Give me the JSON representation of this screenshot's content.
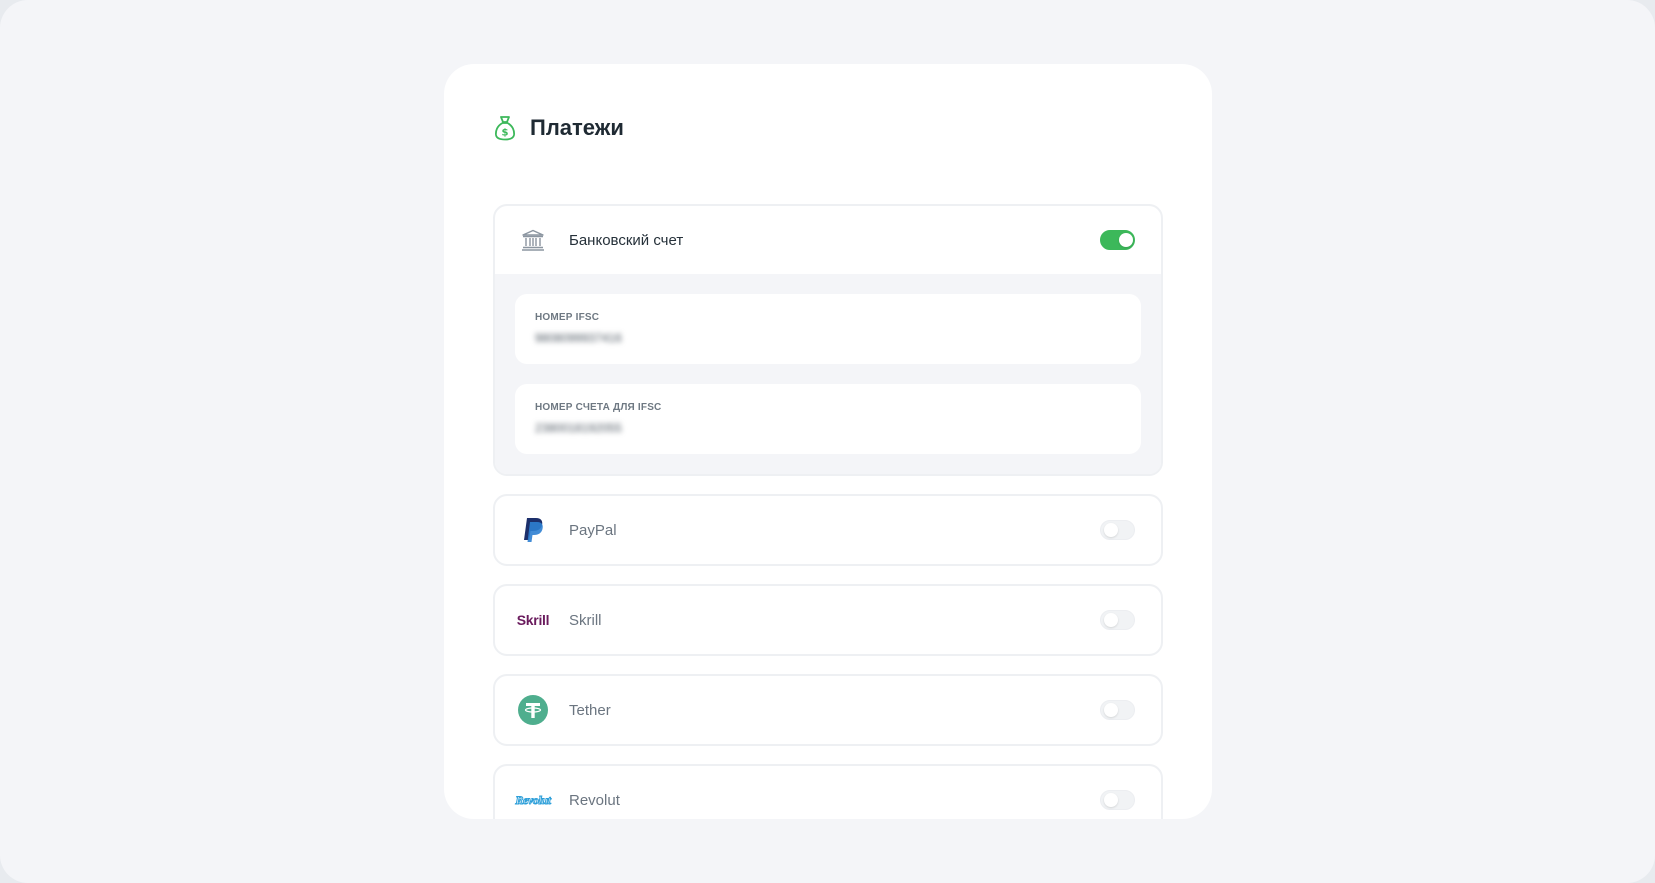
{
  "header": {
    "title": "Платежи",
    "icon": "money-bag-icon"
  },
  "colors": {
    "accent": "#3cb85a",
    "tether": "#4fae8e",
    "skrill": "#6a1b5d",
    "paypal_dark": "#1c2f6b",
    "paypal_light": "#2d7fd1",
    "revolut": "#2d9fd9"
  },
  "bank": {
    "label": "Банковский счет",
    "enabled": true,
    "fields": [
      {
        "label": "НОМЕР IFSC",
        "value": "9808099937416"
      },
      {
        "label": "НОМЕР СЧЕТА ДЛЯ IFSC",
        "value": "2380018192055"
      }
    ]
  },
  "methods": [
    {
      "id": "paypal",
      "label": "PayPal",
      "icon": "paypal-icon",
      "enabled": false
    },
    {
      "id": "skrill",
      "label": "Skrill",
      "icon": "skrill-logo",
      "logo_text": "Skrill",
      "enabled": false
    },
    {
      "id": "tether",
      "label": "Tether",
      "icon": "tether-icon",
      "enabled": false
    },
    {
      "id": "revolut",
      "label": "Revolut",
      "icon": "revolut-logo",
      "logo_text": "Revolut",
      "enabled": false
    }
  ]
}
